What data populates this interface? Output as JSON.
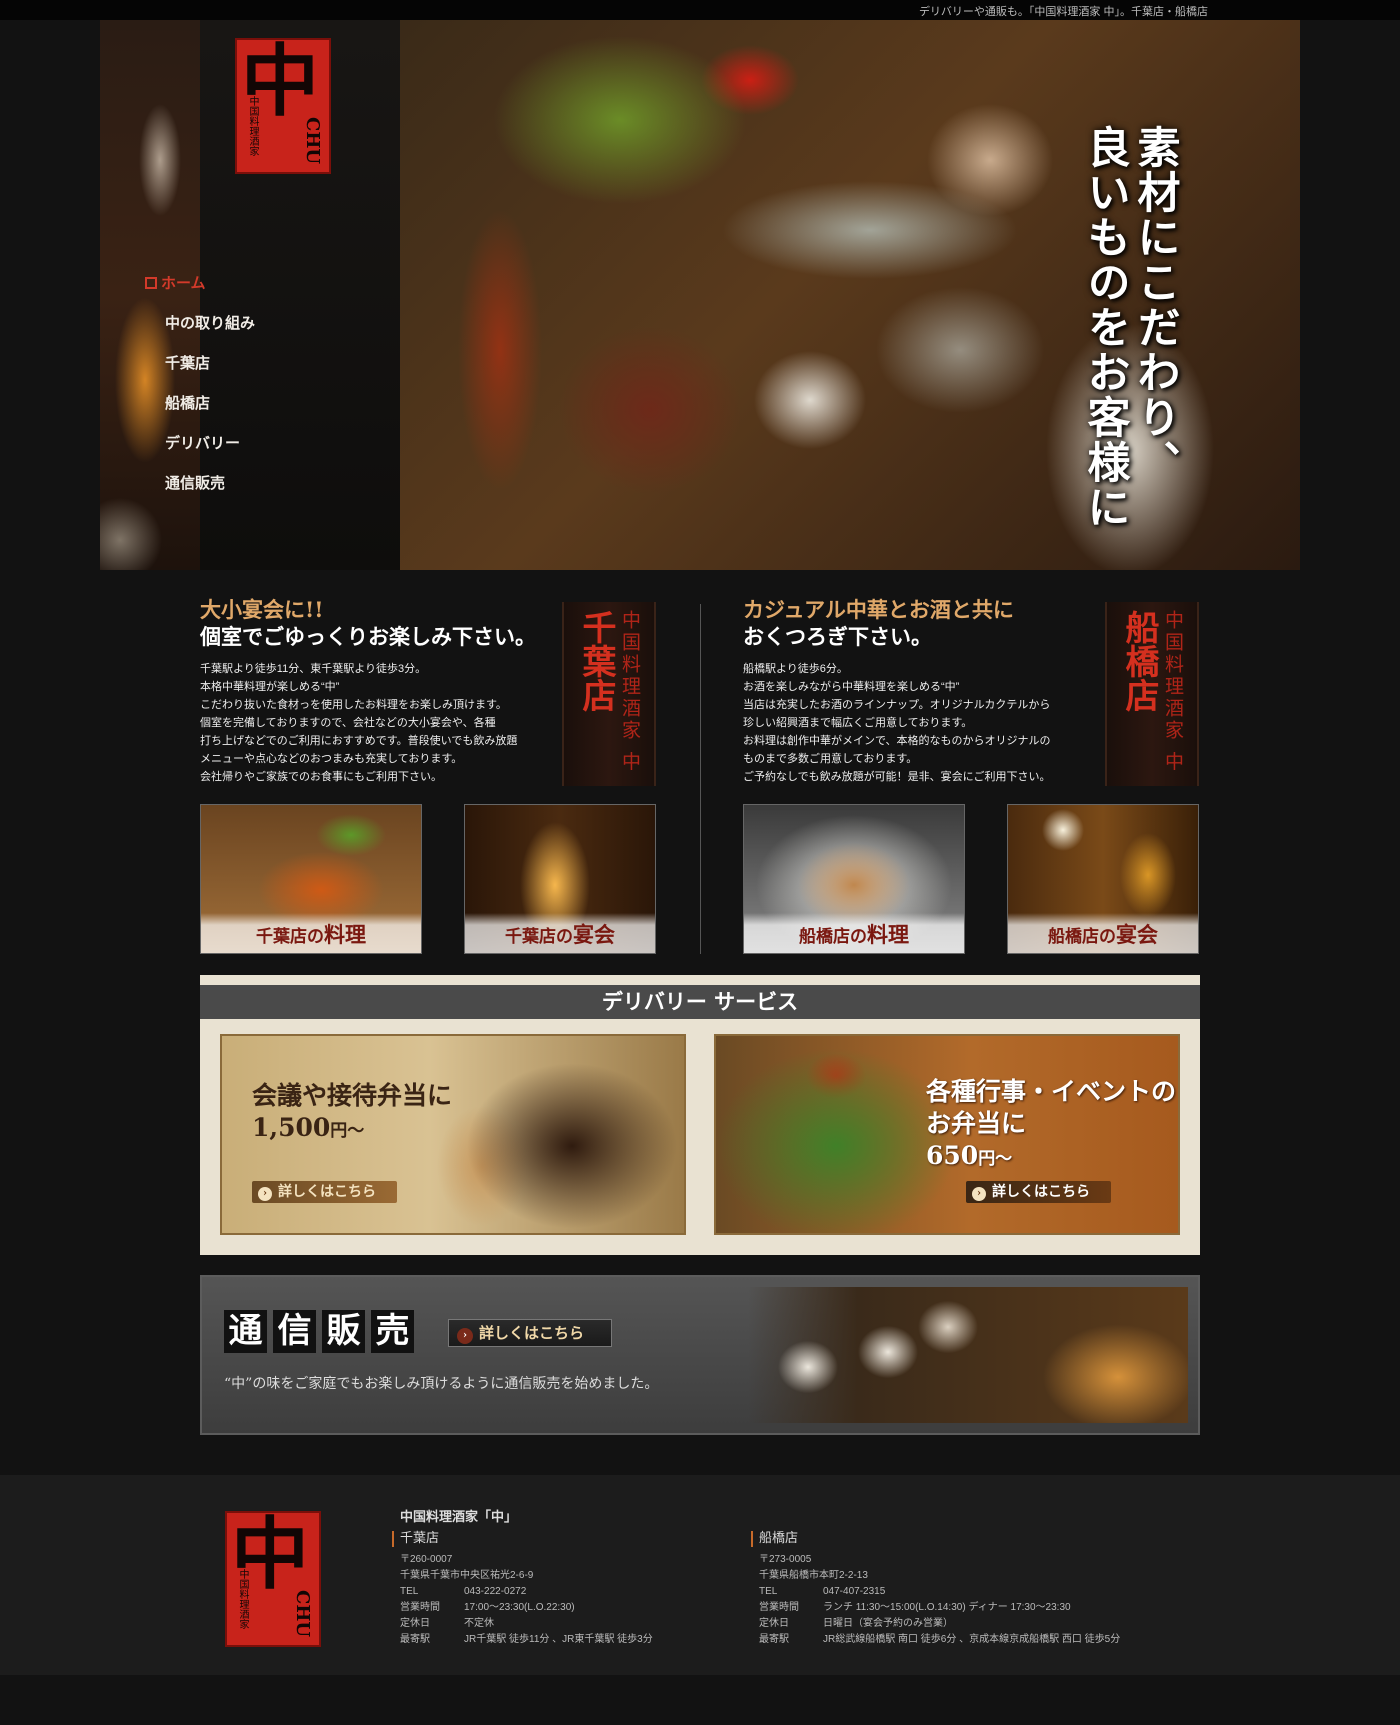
{
  "top_bar": {
    "tagline": "デリバリーや通販も。「中国料理酒家 中」。千葉店・船橋店"
  },
  "logo": {
    "glyph": "中",
    "sub": "中国料理酒家",
    "roman": "CHU"
  },
  "nav": {
    "items": [
      {
        "label": "ホーム",
        "active": true
      },
      {
        "label": "中の取り組み"
      },
      {
        "label": "千葉店"
      },
      {
        "label": "船橋店"
      },
      {
        "label": "デリバリー"
      },
      {
        "label": "通信販売"
      }
    ]
  },
  "hero": {
    "slogan_line1": "素材にこだわり、",
    "slogan_line2": "良いものをお客様に"
  },
  "chiba": {
    "headline1": "大小宴会に!!",
    "headline2": "個室でごゆっくりお楽しみ下さい。",
    "desc": [
      "千葉駅より徒歩11分、東千葉駅より徒歩3分。",
      "本格中華料理が楽しめる“中”",
      "こだわり抜いた食材っを使用したお料理をお楽しみ頂けます。",
      "個室を完備しておりますので、会社などの大小宴会や、各種",
      "打ち上げなどでのご利用におすすめです。普段使いでも飲み放題",
      "メニューや点心などのおつまみも充実しております。",
      "会社帰りやご家族でのお食事にもご利用下さい。"
    ],
    "tag_name": "千葉店",
    "tag_genre": "中国料理酒家 中",
    "photo1_prefix": "千葉店の",
    "photo1_big": "料理",
    "photo2_prefix": "千葉店の",
    "photo2_big": "宴会"
  },
  "funabashi": {
    "headline1": "カジュアル中華とお酒と共に",
    "headline2": "おくつろぎ下さい。",
    "desc": [
      "船橋駅より徒歩6分。",
      "お酒を楽しみながら中華料理を楽しめる“中”",
      "当店は充実したお酒のラインナップ。オリジナルカクテルから",
      "珍しい紹興酒まで幅広くご用意しております。",
      "お料理は創作中華がメインで、本格的なものからオリジナルの",
      "ものまで多数ご用意しております。",
      "ご予約なしでも飲み放題が可能！是非、宴会にご利用下さい。"
    ],
    "tag_name": "船橋店",
    "tag_genre": "中国料理酒家 中",
    "photo1_prefix": "船橋店の",
    "photo1_big": "料理",
    "photo2_prefix": "船橋店の",
    "photo2_big": "宴会"
  },
  "delivery": {
    "heading": "デリバリー サービス",
    "left": {
      "line1": "会議や接待弁当に",
      "price": "1,500",
      "yen": "円～",
      "more": "詳しくはこちら"
    },
    "right": {
      "line1": "各種行事・イベントの",
      "line2": "お弁当に",
      "price": "650",
      "yen": "円～",
      "more": "詳しくはこちら"
    }
  },
  "mailorder": {
    "title_chars": [
      "通",
      "信",
      "販",
      "売"
    ],
    "more": "詳しくはこちら",
    "desc": "“中”の味をご家庭でもお楽しみ頂けるように通信販売を始めました。"
  },
  "footer": {
    "name": "中国料理酒家「中」",
    "chiba": {
      "name": "千葉店",
      "zip": "〒260-0007",
      "address": "千葉県千葉市中央区祐光2-6-9",
      "rows": [
        {
          "k": "TEL",
          "v": "043-222-0272"
        },
        {
          "k": "営業時間",
          "v": "17:00～23:30(L.O.22:30)"
        },
        {
          "k": "定休日",
          "v": "不定休"
        },
        {
          "k": "最寄駅",
          "v": "JR千葉駅 徒歩11分 、JR東千葉駅 徒歩3分"
        }
      ]
    },
    "funabashi": {
      "name": "船橋店",
      "zip": "〒273-0005",
      "address": "千葉県船橋市本町2-2-13",
      "rows": [
        {
          "k": "TEL",
          "v": "047-407-2315"
        },
        {
          "k": "営業時間",
          "v": "ランチ 11:30～15:00(L.O.14:30) ディナー 17:30～23:30"
        },
        {
          "k": "定休日",
          "v": "日曜日（宴会予約のみ営業）"
        },
        {
          "k": "最寄駅",
          "v": "JR総武線船橋駅 南口 徒歩6分 、京成本線京成船橋駅 西口 徒歩5分"
        }
      ]
    }
  },
  "colors": {
    "brand_red": "#c8231b",
    "accent_gold": "#e0a869",
    "background": "#121212"
  }
}
